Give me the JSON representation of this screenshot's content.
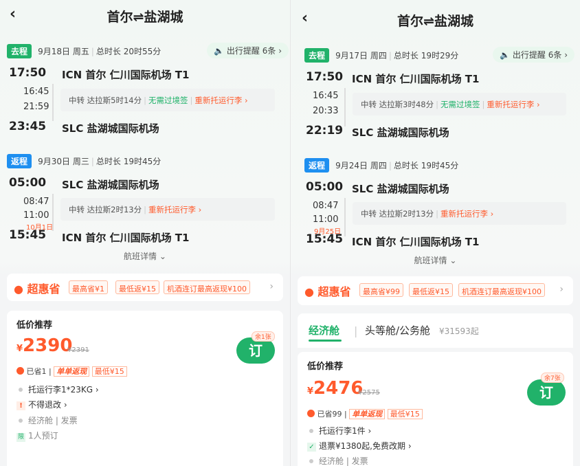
{
  "panels": [
    {
      "title": "首尔⇌盐湖城",
      "outbound": {
        "tag": "去程",
        "date": "9月18日",
        "weekday": "周五",
        "duration": "总时长 20时55分",
        "remind": "出行提醒 6条",
        "dep_time": "17:50",
        "dep_airport": "ICN 首尔 仁川国际机场 T1",
        "stop_arr": "16:45",
        "stop_dep": "21:59",
        "stop_text": "中转 达拉斯5时14分",
        "stop_visa": "无需过境签",
        "stop_bag": "重新托运行李",
        "arr_time": "23:45",
        "arr_airport": "SLC 盐湖城国际机场"
      },
      "return": {
        "tag": "返程",
        "date": "9月30日",
        "weekday": "周三",
        "duration": "总时长 19时45分",
        "dep_time": "05:00",
        "dep_airport": "SLC 盐湖城国际机场",
        "stop_arr": "08:47",
        "stop_dep": "11:00",
        "stop_text": "中转 达拉斯2时13分",
        "stop_bag": "重新托运行李",
        "next_day": "10月1日",
        "arr_time": "15:45",
        "arr_airport": "ICN 首尔 仁川国际机场 T1"
      },
      "details": "航班详情",
      "savings": {
        "logo": "超惠省",
        "chips": [
          "最高省¥1",
          "最低返¥15",
          "机酒连订最高返现¥100"
        ]
      },
      "card": {
        "label": "低价推荐",
        "currency": "¥",
        "price": "2390",
        "old": "¥2391",
        "book": "订",
        "remain": "余1张",
        "saved": "已省1",
        "cash": "单单返现",
        "cash_min": "最低¥15",
        "rows": [
          "托运行李1*23KG",
          "不得退改",
          "经济舱 | 发票",
          "1人预订"
        ]
      }
    },
    {
      "title": "首尔⇌盐湖城",
      "outbound": {
        "tag": "去程",
        "date": "9月17日",
        "weekday": "周四",
        "duration": "总时长 19时29分",
        "remind": "出行提醒 6条",
        "dep_time": "17:50",
        "dep_airport": "ICN 首尔 仁川国际机场 T1",
        "stop_arr": "16:45",
        "stop_dep": "20:33",
        "stop_text": "中转 达拉斯3时48分",
        "stop_visa": "无需过境签",
        "stop_bag": "重新托运行李",
        "arr_time": "22:19",
        "arr_airport": "SLC 盐湖城国际机场"
      },
      "return": {
        "tag": "返程",
        "date": "9月24日",
        "weekday": "周四",
        "duration": "总时长 19时45分",
        "dep_time": "05:00",
        "dep_airport": "SLC 盐湖城国际机场",
        "stop_arr": "08:47",
        "stop_dep": "11:00",
        "stop_text": "中转 达拉斯2时13分",
        "stop_bag": "重新托运行李",
        "next_day": "9月25日",
        "arr_time": "15:45",
        "arr_airport": "ICN 首尔 仁川国际机场 T1"
      },
      "details": "航班详情",
      "savings": {
        "logo": "超惠省",
        "chips": [
          "最高省¥99",
          "最低返¥15",
          "机酒连订最高返现¥100"
        ]
      },
      "cabin": {
        "tab1": "经济舱",
        "tab2": "头等舱/公务舱",
        "tab2_price": "¥31593起"
      },
      "card": {
        "label": "低价推荐",
        "currency": "¥",
        "price": "2476",
        "old": "¥2575",
        "book": "订",
        "remain": "余7张",
        "saved": "已省99",
        "cash": "单单返现",
        "cash_min": "最低¥15",
        "rows": [
          "托运行李1件",
          "退票¥1380起,免费改期",
          "经济舱 | 发票"
        ]
      }
    }
  ],
  "colors": {
    "accent": "#21b26a",
    "price": "#ff5a2c",
    "return_tag": "#1e8ff0"
  },
  "icons": {
    "back": "chevron-left-icon",
    "speaker": "speaker-icon",
    "coin": "coin-icon"
  }
}
